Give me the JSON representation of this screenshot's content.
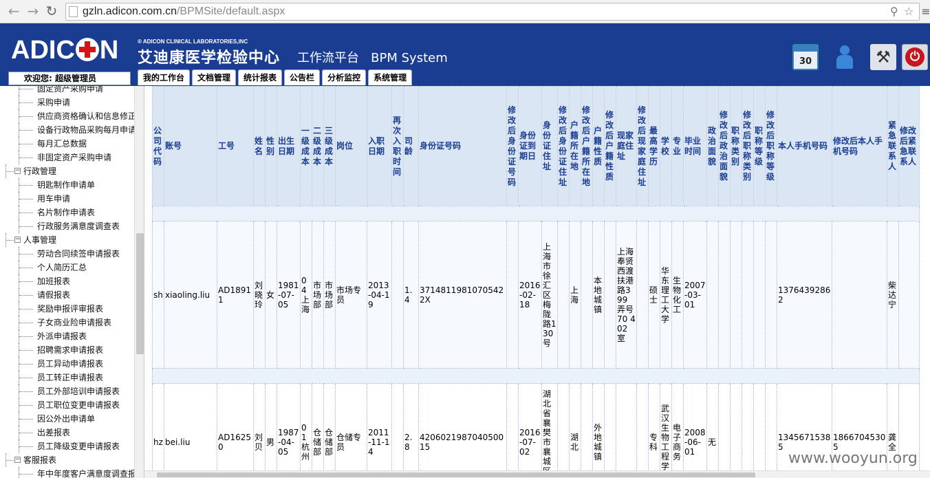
{
  "browser": {
    "url_host": "gzln.adicon.com.cn",
    "url_path": "/BPMSite/default.aspx",
    "back_icon": "back-arrow-icon",
    "forward_icon": "forward-arrow-icon",
    "reload_icon": "reload-icon",
    "key_icon": "key-icon",
    "star_icon": "star-icon",
    "menu_icon": "menu-icon"
  },
  "header": {
    "logo_text_left": "ADIC",
    "logo_text_right": "N",
    "logo_en": "® ADICON CLINICAL LABORATORIES,INC",
    "logo_cn": "艾迪康医学检验中心",
    "platform": "工作流平台   BPM System",
    "calendar_day": "30",
    "brand_color": "#1a3d91"
  },
  "welcome": "欢迎您:  超级管理员",
  "tabs": [
    "我的工作台",
    "文档管理",
    "统计报表",
    "公告栏",
    "分析监控",
    "系统管理"
  ],
  "sidebar": {
    "items": [
      {
        "type": "leaf",
        "label": "固定资产采购申请"
      },
      {
        "type": "leaf",
        "label": "采购申请"
      },
      {
        "type": "leaf",
        "label": "供应商资格确认和信息修正"
      },
      {
        "type": "leaf",
        "label": "设备行政物品采购每月申请"
      },
      {
        "type": "leaf",
        "label": "每月汇总数据"
      },
      {
        "type": "leaf",
        "label": "非固定资产采购申请"
      },
      {
        "type": "group",
        "label": "行政管理"
      },
      {
        "type": "leaf",
        "label": "钥匙制作申请单"
      },
      {
        "type": "leaf",
        "label": "用车申请"
      },
      {
        "type": "leaf",
        "label": "名片制作申请表"
      },
      {
        "type": "leaf",
        "label": "行政服务满意度调查表"
      },
      {
        "type": "group",
        "label": "人事管理"
      },
      {
        "type": "leaf",
        "label": "劳动合同续签申请报表"
      },
      {
        "type": "leaf",
        "label": "个人简历汇总"
      },
      {
        "type": "leaf",
        "label": "加班报表"
      },
      {
        "type": "leaf",
        "label": "请假报表"
      },
      {
        "type": "leaf",
        "label": "奖励申报评审报表"
      },
      {
        "type": "leaf",
        "label": "子女商业险申请报表"
      },
      {
        "type": "leaf",
        "label": "外派申请报表"
      },
      {
        "type": "leaf",
        "label": "招聘需求申请报表"
      },
      {
        "type": "leaf",
        "label": "员工异动申请报表"
      },
      {
        "type": "leaf",
        "label": "员工转正申请报表"
      },
      {
        "type": "leaf",
        "label": "员工外部培训申请报表"
      },
      {
        "type": "leaf",
        "label": "员工职位变更申请报表"
      },
      {
        "type": "leaf",
        "label": "因公外出申请单"
      },
      {
        "type": "leaf",
        "label": "出差报表"
      },
      {
        "type": "leaf",
        "label": "员工降级变更申请报表"
      },
      {
        "type": "group",
        "label": "客服报表"
      },
      {
        "type": "leaf",
        "label": "年中年度客户满意度调查报表"
      }
    ]
  },
  "table": {
    "columns": [
      "公司代码",
      "账号",
      "工号",
      "姓名",
      "性别",
      "出生日期",
      "一级成本",
      "二级成本",
      "三级成本",
      "岗位",
      "入职日期",
      "再次入职时间",
      "司龄",
      "身份证号码",
      "修改后身份证号码",
      "身份证到期日",
      "身份证住址",
      "修改后身份证住址",
      "户籍所在地",
      "修改后户籍所在地",
      "户籍性质",
      "修改后户籍性质",
      "现家庭住址",
      "修改后现家庭住址",
      "最高学历",
      "学校",
      "专业",
      "毕业时间",
      "政治面貌",
      "修改后政治面貌",
      "职称类别",
      "修改后职称类别",
      "职称等级",
      "修改后职称等级",
      "本人手机号码",
      "修改后本人手机号码",
      "紧急联系人",
      "修改后紧急联系人"
    ],
    "rows": [
      [
        "sh",
        "xiaoling.liu",
        "AD18911",
        "刘晓玲",
        "女",
        "1981-07-05",
        "04上海",
        "市场部",
        "市场部",
        "市场专员",
        "2013-04-19",
        "",
        "1.4",
        "37148119810705422X",
        "",
        "2016-02-18",
        "上海市徐汇区梅陇路130号",
        "",
        "上海",
        "",
        "本地城镇",
        "",
        "上海奉贤西渡扶港路399弄号70 402室",
        "",
        "硕士",
        "华东理工大学",
        "生物化工",
        "2007-03-01",
        "",
        "",
        "",
        "",
        "",
        "",
        "13764392862",
        "",
        "柴达宁",
        ""
      ],
      [
        "hz",
        "bei.liu",
        "AD16250",
        "刘贝",
        "男",
        "1987-04-05",
        "01杭州",
        "仓储部",
        "仓储部",
        "仓储专员",
        "2011-11-14",
        "",
        "2.8",
        "420602198704050015",
        "",
        "2016-07-02",
        "湖北省襄樊市襄城区新城",
        "",
        "湖北",
        "",
        "外地城镇",
        "",
        "",
        "",
        "专科",
        "武汉生物工程学院",
        "电子商务",
        "2008-06-01",
        "无",
        "",
        "",
        "",
        "",
        "",
        "13456715385",
        "18667045305",
        "龚全",
        ""
      ]
    ]
  },
  "watermark": "www.wooyun.org"
}
